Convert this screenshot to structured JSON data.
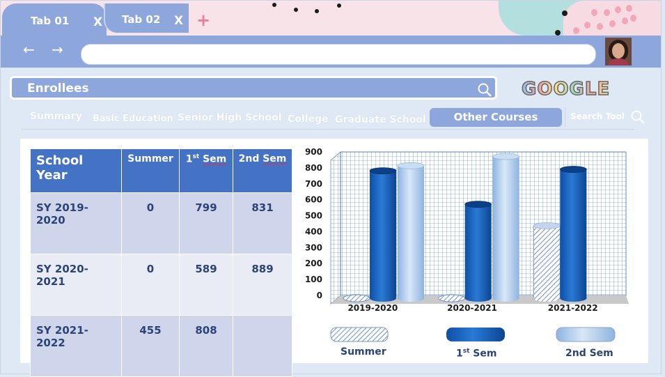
{
  "browser": {
    "tabs": [
      {
        "label": "Tab 01",
        "close": "X"
      },
      {
        "label": "Tab 02",
        "close": "X"
      }
    ],
    "add_tab": "+",
    "back": "←",
    "forward": "→",
    "address_value": ""
  },
  "search": {
    "value": "Enrollees",
    "engine_logo": "GOOGLE"
  },
  "nav": {
    "items": [
      "Summary",
      "Basic Education",
      "Senior High School",
      "College",
      "Graduate School"
    ],
    "active": "Other Courses",
    "search_tool": "Search Tool"
  },
  "table": {
    "headers": {
      "school_year": "School Year",
      "summer": "Summer",
      "first_sem_num": "1",
      "first_sem_sup": "st",
      "first_sem_word": "Sem",
      "second_sem_prefix": "2nd",
      "second_sem_word": "Sem"
    },
    "rows": [
      {
        "sy": "SY 2019-2020",
        "summer": "0",
        "first": "799",
        "second": "831"
      },
      {
        "sy": "SY 2020-2021",
        "summer": "0",
        "first": "589",
        "second": "889"
      },
      {
        "sy": "SY 2021-2022",
        "summer": "455",
        "first": "808",
        "second": ""
      }
    ]
  },
  "chart_data": {
    "type": "bar",
    "categories": [
      "2019-2020",
      "2020-2021",
      "2021-2022"
    ],
    "series": [
      {
        "name": "Summer",
        "values": [
          0,
          0,
          455
        ]
      },
      {
        "name": "1st Sem",
        "values": [
          799,
          589,
          808
        ]
      },
      {
        "name": "2nd Sem",
        "values": [
          831,
          889,
          null
        ]
      }
    ],
    "ylim": [
      0,
      900
    ],
    "yticks": [
      "0",
      "100",
      "200",
      "300",
      "400",
      "500",
      "600",
      "700",
      "800",
      "900"
    ],
    "grid": true,
    "legend_position": "bottom",
    "colors": {
      "Summer": "#b7c7e6",
      "1st Sem": "#1f63bb",
      "2nd Sem": "#a9c8ec"
    }
  },
  "legend": {
    "summer": "Summer",
    "first_num": "1",
    "first_sup": "st",
    "first_word": "Sem",
    "second": "2nd Sem"
  }
}
